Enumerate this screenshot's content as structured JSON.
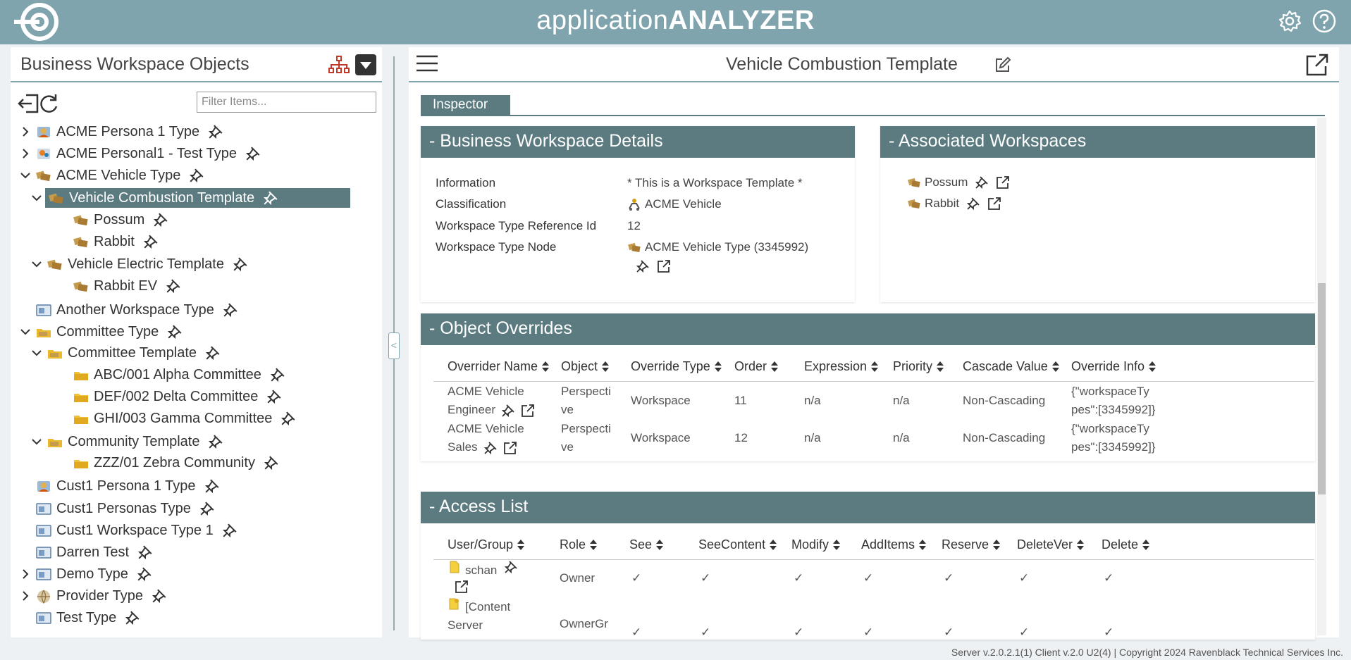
{
  "app": {
    "title_thin": "application",
    "title_bold": "ANALYZER"
  },
  "left_panel": {
    "title": "Business Workspace Objects",
    "filter_placeholder": "Filter Items...",
    "tree": [
      {
        "label": "ACME Persona 1 Type",
        "level": 0,
        "chevron": "right",
        "icon": "persona-type-icon",
        "selected": false
      },
      {
        "label": "ACME Personal1 - Test Type",
        "level": 0,
        "chevron": "right",
        "icon": "persona-test-type-icon",
        "selected": false
      },
      {
        "label": "ACME Vehicle Type",
        "level": 0,
        "chevron": "down",
        "icon": "workspace-type-icon",
        "selected": false
      },
      {
        "label": "Vehicle Combustion Template",
        "level": 1,
        "chevron": "down",
        "icon": "workspace-template-icon",
        "selected": true
      },
      {
        "label": "Possum",
        "level": 2,
        "chevron": "none",
        "icon": "workspace-icon",
        "selected": false
      },
      {
        "label": "Rabbit",
        "level": 2,
        "chevron": "none",
        "icon": "workspace-icon",
        "selected": false
      },
      {
        "label": "Vehicle Electric Template",
        "level": 1,
        "chevron": "down",
        "icon": "workspace-template-icon",
        "selected": false
      },
      {
        "label": "Rabbit EV",
        "level": 2,
        "chevron": "none",
        "icon": "workspace-icon",
        "selected": false
      },
      {
        "label": "Another Workspace Type",
        "level": 0,
        "chevron": "none",
        "icon": "window-type-icon",
        "selected": false
      },
      {
        "label": "Committee Type",
        "level": 0,
        "chevron": "down",
        "icon": "folder-type-icon",
        "selected": false
      },
      {
        "label": "Committee Template",
        "level": 1,
        "chevron": "down",
        "icon": "folder-template-icon",
        "selected": false
      },
      {
        "label": "ABC/001 Alpha Committee",
        "level": 2,
        "chevron": "none",
        "icon": "folder-icon",
        "selected": false
      },
      {
        "label": "DEF/002 Delta Committee",
        "level": 2,
        "chevron": "none",
        "icon": "folder-icon",
        "selected": false
      },
      {
        "label": "GHI/003 Gamma Committee",
        "level": 2,
        "chevron": "none",
        "icon": "folder-icon",
        "selected": false
      },
      {
        "label": "Community Template",
        "level": 1,
        "chevron": "down",
        "icon": "folder-template-icon",
        "selected": false
      },
      {
        "label": "ZZZ/01 Zebra Community",
        "level": 2,
        "chevron": "none",
        "icon": "folder-icon",
        "selected": false
      },
      {
        "label": "Cust1 Persona 1 Type",
        "level": 0,
        "chevron": "none",
        "icon": "persona-type-icon",
        "selected": false
      },
      {
        "label": "Cust1 Personas Type",
        "level": 0,
        "chevron": "none",
        "icon": "window-type-icon",
        "selected": false
      },
      {
        "label": "Cust1 Workspace Type 1",
        "level": 0,
        "chevron": "none",
        "icon": "window-type-icon",
        "selected": false
      },
      {
        "label": "Darren Test",
        "level": 0,
        "chevron": "none",
        "icon": "window-type-icon",
        "selected": false
      },
      {
        "label": "Demo Type",
        "level": 0,
        "chevron": "right",
        "icon": "window-type-icon",
        "selected": false
      },
      {
        "label": "Provider Type",
        "level": 0,
        "chevron": "right",
        "icon": "globe-type-icon",
        "selected": false
      },
      {
        "label": "Test Type",
        "level": 0,
        "chevron": "none",
        "icon": "window-type-icon",
        "selected": false
      }
    ]
  },
  "main": {
    "title": "Vehicle Combustion Template",
    "tab": "Inspector",
    "details": {
      "heading": "- Business Workspace Details",
      "rows": [
        {
          "key": "Information",
          "value": "* This is a Workspace Template *"
        },
        {
          "key": "Classification",
          "value": "ACME Vehicle"
        },
        {
          "key": "Workspace Type Reference Id",
          "value": "12"
        },
        {
          "key": "Workspace Type Node",
          "value": "ACME Vehicle Type (3345992)"
        }
      ]
    },
    "associated": {
      "heading": "- Associated Workspaces",
      "items": [
        "Possum",
        "Rabbit"
      ]
    },
    "overrides": {
      "heading": "- Object Overrides",
      "columns": [
        "Overrider Name",
        "Object",
        "Override Type",
        "Order",
        "Expression",
        "Priority",
        "Cascade Value",
        "Override Info"
      ],
      "rows": [
        {
          "name_l1": "ACME Vehicle",
          "name_l2": "Engineer",
          "object_l1": "Perspecti",
          "object_l2": "ve",
          "type": "Workspace",
          "order": "11",
          "expression": "n/a",
          "priority": "n/a",
          "cascade": "Non-Cascading",
          "info_l1": "{\"workspaceTy",
          "info_l2": "pes\":[3345992]}"
        },
        {
          "name_l1": "ACME Vehicle",
          "name_l2": "Sales",
          "object_l1": "Perspecti",
          "object_l2": "ve",
          "type": "Workspace",
          "order": "12",
          "expression": "n/a",
          "priority": "n/a",
          "cascade": "Non-Cascading",
          "info_l1": "{\"workspaceTy",
          "info_l2": "pes\":[3345992]}"
        }
      ]
    },
    "access": {
      "heading": "- Access List",
      "columns": [
        "User/Group",
        "Role",
        "See",
        "SeeContent",
        "Modify",
        "AddItems",
        "Reserve",
        "DeleteVer",
        "Delete"
      ],
      "rows": [
        {
          "user": "schan",
          "role": "Owner",
          "check": "✓"
        },
        {
          "user_l1": "[Content",
          "user_l2": "Server",
          "role": "OwnerGr",
          "check": "✓"
        }
      ]
    }
  },
  "footer": {
    "text": "Server v.2.0.2.1(1) Client v.2.0 U2(4) | Copyright 2024 Ravenblack Technical Services Inc."
  }
}
